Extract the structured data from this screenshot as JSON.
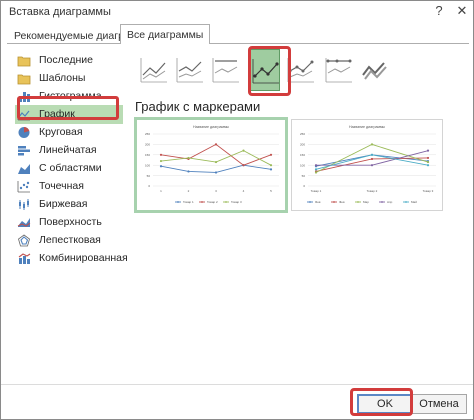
{
  "window": {
    "title": "Вставка диаграммы",
    "help_label": "?",
    "close_label": "✕"
  },
  "tabs": [
    {
      "label": "Рекомендуемые диаграммы"
    },
    {
      "label": "Все диаграммы"
    }
  ],
  "sidebar": {
    "items": [
      {
        "label": "Последние",
        "icon": "recent-folder-icon"
      },
      {
        "label": "Шаблоны",
        "icon": "templates-folder-icon"
      },
      {
        "label": "Гистограмма",
        "icon": "column-chart-icon"
      },
      {
        "label": "График",
        "icon": "line-chart-icon"
      },
      {
        "label": "Круговая",
        "icon": "pie-chart-icon"
      },
      {
        "label": "Линейчатая",
        "icon": "bar-chart-icon"
      },
      {
        "label": "С областями",
        "icon": "area-chart-icon"
      },
      {
        "label": "Точечная",
        "icon": "scatter-chart-icon"
      },
      {
        "label": "Биржевая",
        "icon": "stock-chart-icon"
      },
      {
        "label": "Поверхность",
        "icon": "surface-chart-icon"
      },
      {
        "label": "Лепестковая",
        "icon": "radar-chart-icon"
      },
      {
        "label": "Комбинированная",
        "icon": "combo-chart-icon"
      }
    ],
    "selected": "График"
  },
  "gallery": {
    "items": [
      "line-chart-icon",
      "stacked-line-chart-icon",
      "percent-stacked-line-chart-icon",
      "line-with-markers-chart-icon",
      "stacked-line-with-markers-chart-icon",
      "percent-stacked-line-with-markers-chart-icon",
      "3d-line-chart-icon"
    ],
    "selected_index": 3
  },
  "chart_heading": "График с маркерами",
  "colors": {
    "selected_bg": "#b9dcb4",
    "highlight_red": "#d23c3c",
    "series_blue": "#4f81bd",
    "series_red": "#c0504d",
    "series_green": "#9bbb59",
    "series_purple": "#8064a2"
  },
  "chart_data": [
    {
      "type": "line",
      "title": "Название диаграммы",
      "x": [
        "1",
        "2",
        "3",
        "4",
        "5"
      ],
      "ylim": [
        0,
        250
      ],
      "yticks": [
        "250",
        "200",
        "150",
        "100",
        "50",
        "0"
      ],
      "series": [
        {
          "name": "Товар 1",
          "values": [
            95,
            70,
            65,
            100,
            80
          ]
        },
        {
          "name": "Товар 2",
          "values": [
            150,
            130,
            200,
            100,
            150
          ]
        },
        {
          "name": "Товар 3",
          "values": [
            120,
            135,
            115,
            170,
            100
          ]
        }
      ],
      "legend": "bottom"
    },
    {
      "type": "line",
      "title": "Название диаграммы",
      "x": [
        "Товар 1",
        "Товар 2",
        "Товар 3"
      ],
      "ylim": [
        0,
        250
      ],
      "yticks": [
        "250",
        "200",
        "150",
        "100",
        "50",
        "0"
      ],
      "series": [
        {
          "name": "Янв",
          "values": [
            95,
            150,
            120
          ]
        },
        {
          "name": "Фев",
          "values": [
            70,
            130,
            135
          ]
        },
        {
          "name": "Мар",
          "values": [
            65,
            200,
            115
          ]
        },
        {
          "name": "Апр",
          "values": [
            100,
            100,
            170
          ]
        },
        {
          "name": "Май",
          "values": [
            80,
            150,
            100
          ]
        }
      ],
      "legend": "bottom"
    }
  ],
  "footer": {
    "ok_label": "OK",
    "cancel_label": "Отмена"
  }
}
